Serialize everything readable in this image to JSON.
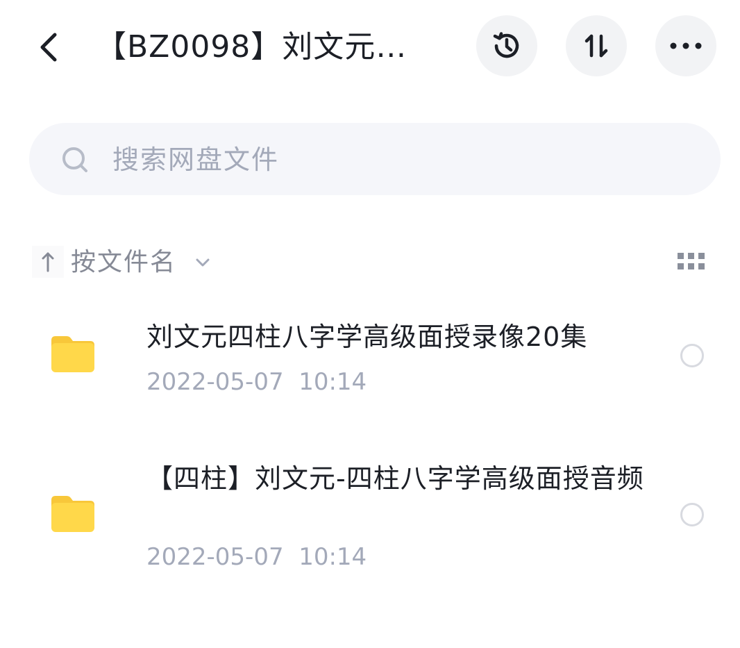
{
  "header": {
    "title": "【BZ0098】刘文元…",
    "back_icon": "chevron-left-icon",
    "history_icon": "history-icon",
    "sort_icon": "sort-arrows-icon",
    "more_icon": "more-dots-icon"
  },
  "search": {
    "placeholder": "搜索网盘文件",
    "value": ""
  },
  "sort_bar": {
    "direction_icon": "arrow-up-icon",
    "label": "按文件名",
    "dropdown_icon": "chevron-down-icon",
    "view_icon": "grid-view-icon"
  },
  "files": [
    {
      "name": "刘文元四柱八字学高级面授录像20集",
      "date": "2022-05-07  10:14",
      "type_icon": "folder-icon",
      "selected": false
    },
    {
      "name": "【四柱】刘文元-四柱八字学高级面授音频",
      "date": "2022-05-07  10:14",
      "type_icon": "folder-icon",
      "selected": false
    }
  ],
  "colors": {
    "folder": "#FFD84A",
    "folder_tab": "#F8C73A",
    "button_bg": "#F2F3F5",
    "search_bg": "#F5F6FA",
    "muted_text": "#A3A9B9",
    "primary_text": "#1C1F26"
  }
}
